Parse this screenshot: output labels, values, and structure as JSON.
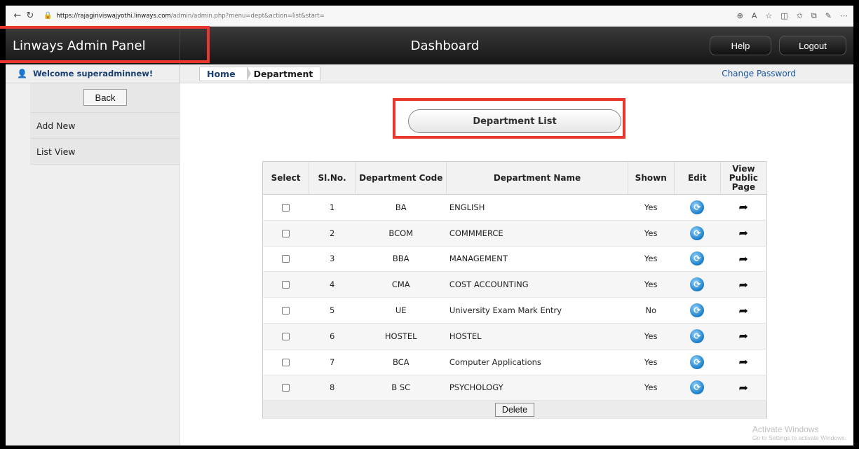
{
  "browser": {
    "url_host": "https://rajagiriviswajyothi.linways.com",
    "url_path": "/admin/admin.php?menu=dept&action=list&start="
  },
  "header": {
    "brand": "Linways Admin Panel",
    "title": "Dashboard",
    "help_label": "Help",
    "logout_label": "Logout"
  },
  "subbar": {
    "welcome": "Welcome superadminnew!",
    "breadcrumb_home": "Home",
    "breadcrumb_current": "Department",
    "change_password": "Change Password"
  },
  "sidebar": {
    "back_label": "Back",
    "items": [
      {
        "label": "Add New"
      },
      {
        "label": "List View"
      }
    ]
  },
  "main": {
    "list_button": "Department List",
    "columns": [
      "Select",
      "Sl.No.",
      "Department Code",
      "Department Name",
      "Shown",
      "Edit",
      "View Public Page"
    ],
    "rows": [
      {
        "slno": "1",
        "code": "BA",
        "name": "ENGLISH",
        "shown": "Yes"
      },
      {
        "slno": "2",
        "code": "BCOM",
        "name": "COMMMERCE",
        "shown": "Yes"
      },
      {
        "slno": "3",
        "code": "BBA",
        "name": "MANAGEMENT",
        "shown": "Yes"
      },
      {
        "slno": "4",
        "code": "CMA",
        "name": "COST ACCOUNTING",
        "shown": "Yes"
      },
      {
        "slno": "5",
        "code": "UE",
        "name": "University Exam Mark Entry",
        "shown": "No"
      },
      {
        "slno": "6",
        "code": "HOSTEL",
        "name": "HOSTEL",
        "shown": "Yes"
      },
      {
        "slno": "7",
        "code": "BCA",
        "name": "Computer Applications",
        "shown": "Yes"
      },
      {
        "slno": "8",
        "code": "B SC",
        "name": "PSYCHOLOGY",
        "shown": "Yes"
      }
    ],
    "delete_label": "Delete"
  },
  "watermark": {
    "line1": "Activate Windows",
    "line2": "Go to Settings to activate Windows."
  },
  "colors": {
    "highlight": "#e8372c",
    "link": "#1a56a0",
    "header_bg": "#1e1e1e"
  }
}
